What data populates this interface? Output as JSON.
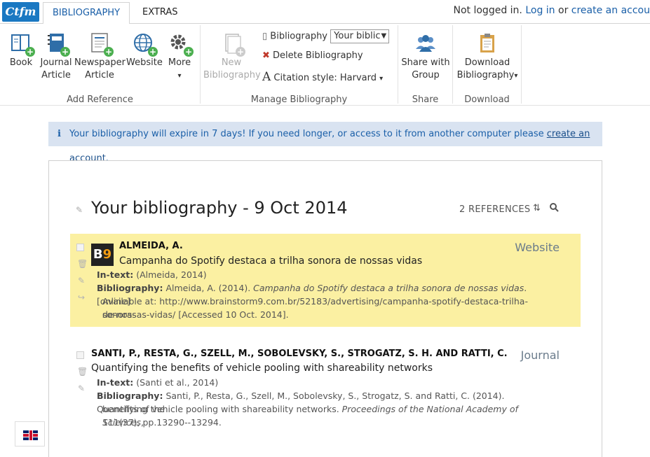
{
  "app": {
    "logo": "Ctfm"
  },
  "tabs": [
    {
      "label": "BIBLIOGRAPHY"
    },
    {
      "label": "EXTRAS"
    }
  ],
  "login": {
    "prefix": "Not logged in.",
    "login_link": "Log in",
    "or": "or",
    "create_link": "create an accou"
  },
  "ribbon": {
    "add_reference": {
      "caption": "Add Reference",
      "buttons": [
        {
          "line1": "Book",
          "line2": "",
          "icon": "book-add-icon"
        },
        {
          "line1": "Journal",
          "line2": "Article",
          "icon": "journal-add-icon"
        },
        {
          "line1": "Newspaper",
          "line2": "Article",
          "icon": "newspaper-add-icon"
        },
        {
          "line1": "Website",
          "line2": "",
          "icon": "globe-add-icon"
        },
        {
          "line1": "More",
          "line2": "▾",
          "icon": "gear-add-icon"
        }
      ]
    },
    "manage": {
      "caption": "Manage Bibliography",
      "new_line1": "New",
      "new_line2": "Bibliography",
      "bibliography_label": "Bibliography",
      "bibliography_select": "Your biblic",
      "delete_label": "Delete Bibliography",
      "citation_label": "Citation style: Harvard"
    },
    "share": {
      "caption": "Share",
      "line1": "Share with",
      "line2": "Group"
    },
    "download": {
      "caption": "Download",
      "line1": "Download",
      "line2": "Bibliography"
    }
  },
  "banner": {
    "text": "Your bibliography will expire in 7 days! If you need longer, or access to it from another computer please ",
    "link": "create an account",
    "end": "."
  },
  "panel": {
    "title": "Your bibliography - 9 Oct 2014",
    "ref_count": "2 REFERENCES ·"
  },
  "references": [
    {
      "type": "Website",
      "author": "ALMEIDA, A.",
      "title": "Campanha do Spotify destaca a trilha sonora de nossas vidas",
      "intext_label": "In-text:",
      "intext": "(Almeida, 2014)",
      "bib_label": "Bibliography:",
      "bib_pre": "Almeida, A. (2014). ",
      "bib_italic": "Campanha do Spotify destaca a trilha sonora de nossas vidas",
      "bib_post": ". [online]",
      "bib_line2": "Available at: http://www.brainstorm9.com.br/52183/advertising/campanha-spotify-destaca-trilha-sonora-",
      "bib_line3": "de-nossas-vidas/ [Accessed 10 Oct. 2014]."
    },
    {
      "type": "Journal",
      "author": "SANTI, P., RESTA, G., SZELL, M., SOBOLEVSKY, S., STROGATZ, S. H. AND RATTI, C.",
      "title": "Quantifying the benefits of vehicle pooling with shareability networks",
      "intext_label": "In-text:",
      "intext": "(Santi et al., 2014)",
      "bib_label": "Bibliography:",
      "bib_pre": "Santi, P., Resta, G., Szell, M., Sobolevsky, S., Strogatz, S. and Ratti, C. (2014). Quantifying the",
      "bib_line2_pre": "benefits of vehicle pooling with shareability networks. ",
      "bib_line2_italic": "Proceedings of the National Academy of Sciences",
      "bib_line2_post": ",",
      "bib_line3": "111(37), pp.13290--13294."
    }
  ]
}
